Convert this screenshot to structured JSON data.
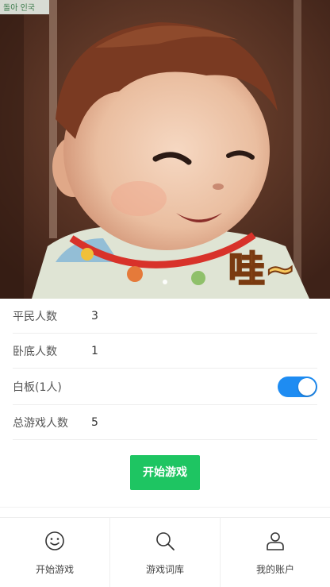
{
  "hero": {
    "watermark": "돌아 인국",
    "caption": "哇~"
  },
  "settings": {
    "rows": [
      {
        "label": "平民人数",
        "value": "3"
      },
      {
        "label": "卧底人数",
        "value": "1"
      },
      {
        "label": "白板(1人)",
        "toggle_on": true
      },
      {
        "label": "总游戏人数",
        "value": "5"
      }
    ]
  },
  "start_button": "开始游戏",
  "tabs": [
    {
      "label": "开始游戏",
      "icon": "smile-icon"
    },
    {
      "label": "游戏词库",
      "icon": "search-icon"
    },
    {
      "label": "我的账户",
      "icon": "user-icon"
    }
  ],
  "colors": {
    "toggle": "#1e8cf2",
    "start_button": "#1ec562"
  }
}
